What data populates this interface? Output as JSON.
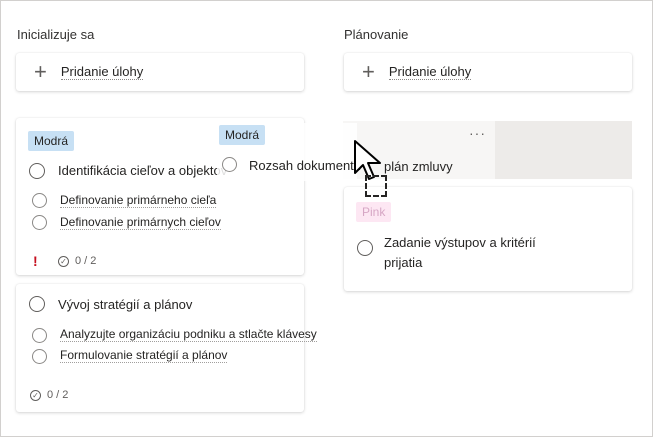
{
  "columns": [
    {
      "title": "Inicializuje sa",
      "add_label": "Pridanie úlohy"
    },
    {
      "title": "Plánovanie",
      "add_label": "Pridanie úlohy"
    }
  ],
  "cards": {
    "card1": {
      "tag": "Modrá",
      "title": "Identifikácia cieľov a objektov",
      "subtasks": [
        "Definovanie primárneho cieľa",
        "Definovanie primárnych cieľov"
      ],
      "progress": "0 / 2",
      "urgent_icon": "!"
    },
    "card2": {
      "title": "Vývoj stratégií a plánov",
      "subtasks": [
        "Analyzujte organizáciu podniku a stlačte klávesy",
        "Formulovanie stratégií a plánov"
      ],
      "progress": "0 / 2"
    },
    "drag": {
      "tag": "Modrá",
      "title": "Rozsah dokumentu",
      "partial": "plán zmluvy"
    },
    "card3": {
      "tag": "Pink",
      "title_line1": "Zadanie výstupov a kritérií",
      "title_line2": "prijatia"
    }
  },
  "more_icon": "···",
  "colors": {
    "accent_blue": "#c7e0f4",
    "pink_tag": "#fde7f3",
    "urgent": "#c50f1f"
  }
}
